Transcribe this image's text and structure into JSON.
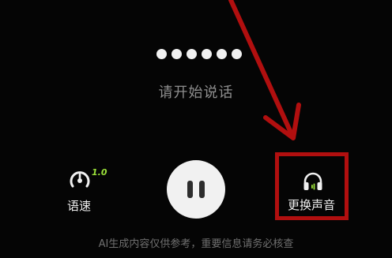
{
  "status": {
    "dot_count": 6,
    "prompt": "请开始说话"
  },
  "controls": {
    "speed": {
      "icon": "speedometer-icon",
      "value": "1.0",
      "label": "语速"
    },
    "pause": {
      "icon": "pause-icon"
    },
    "voice": {
      "icon": "headphones-icon",
      "label": "更换声音"
    }
  },
  "footer": {
    "disclaimer": "AI生成内容仅供参考，重要信息请务必核查"
  },
  "annotation": {
    "arrow_color": "#b10f0f",
    "highlight_color": "#b10f0f"
  },
  "colors": {
    "background": "#050505",
    "accent_green": "#9be23a",
    "button_bg": "#f1f1f1"
  }
}
